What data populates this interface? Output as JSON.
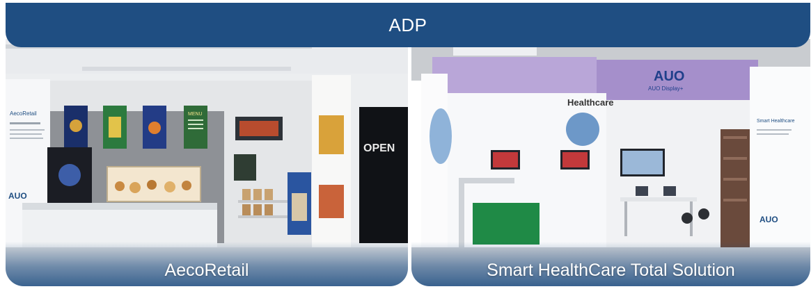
{
  "header": {
    "title": "ADP"
  },
  "panels": [
    {
      "caption": "AecoRetail",
      "signs": {
        "wall_label": "AecoRetail",
        "logo": "AUO",
        "open_sign": "OPEN",
        "menu_label": "MENU"
      }
    },
    {
      "caption": "Smart HealthCare Total Solution",
      "signs": {
        "booth_label": "Healthcare",
        "brand": "AUO",
        "brand_sub": "AUO Display+",
        "smart_label": "Smart Healthcare",
        "logo": "AUO"
      }
    }
  ],
  "colors": {
    "banner": "#1f4e82",
    "caption_text": "#ffffff"
  }
}
